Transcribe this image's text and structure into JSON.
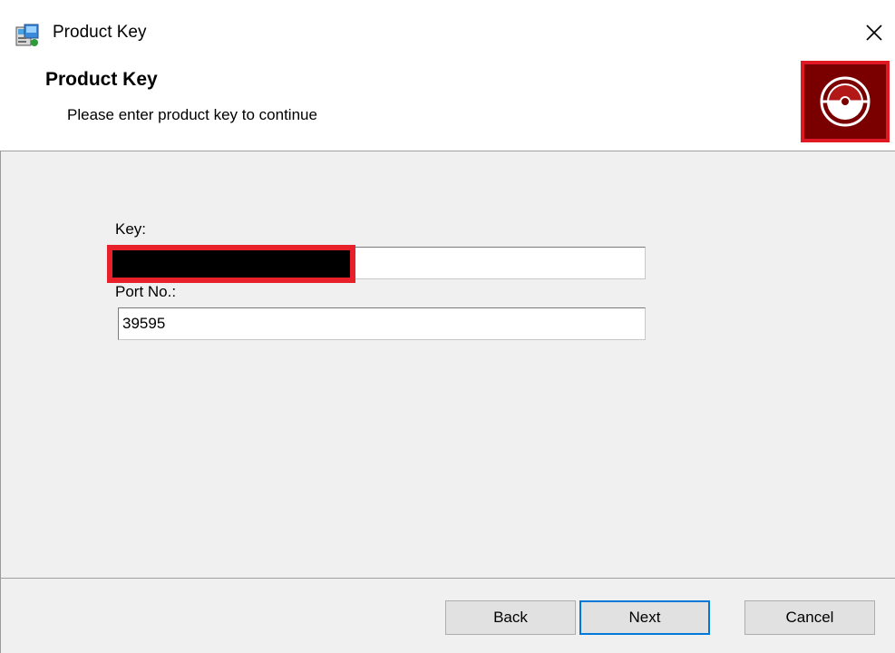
{
  "window": {
    "title": "Product Key"
  },
  "banner": {
    "title": "Product Key",
    "subtitle": "Please enter product key to continue"
  },
  "form": {
    "key": {
      "label": "Key:",
      "value": ""
    },
    "port": {
      "label": "Port No.:",
      "value": "39595"
    }
  },
  "buttons": {
    "back": "Back",
    "next": "Next",
    "cancel": "Cancel"
  },
  "icons": {
    "title": "installer-icon",
    "close": "close-icon",
    "logo": "disc-icon"
  },
  "colors": {
    "logo_bg": "#7a0000",
    "highlight": "#e01a22",
    "default_button_border": "#0078d7"
  }
}
